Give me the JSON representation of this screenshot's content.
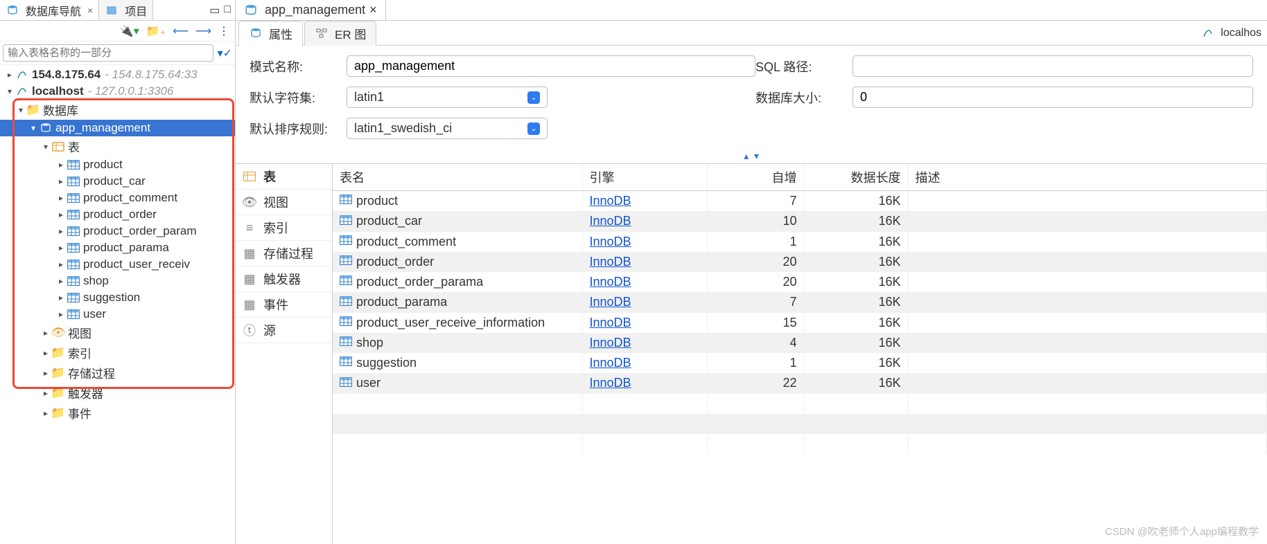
{
  "leftTabs": {
    "nav": "数据库导航",
    "project": "项目"
  },
  "search": {
    "placeholder": "输入表格名称的一部分"
  },
  "servers": [
    {
      "ip": "154.8.175.64",
      "desc": "- 154.8.175.64:33"
    },
    {
      "ip": "localhost",
      "desc": "- 127.0.0.1:3306"
    }
  ],
  "tree": {
    "databasesLabel": "数据库",
    "selectedDb": "app_management",
    "tablesLabel": "表",
    "tables": [
      "product",
      "product_car",
      "product_comment",
      "product_order",
      "product_order_param",
      "product_parama",
      "product_user_receiv",
      "shop",
      "suggestion",
      "user"
    ],
    "categories": [
      "视图",
      "索引",
      "存储过程",
      "触发器",
      "事件"
    ]
  },
  "mainTab": "app_management",
  "subTabs": {
    "props": "属性",
    "er": "ER 图"
  },
  "localhostLabel": "localhos",
  "props": {
    "schemaLabel": "模式名称:",
    "schemaValue": "app_management",
    "charsetLabel": "默认字符集:",
    "charsetValue": "latin1",
    "collationLabel": "默认排序规则:",
    "collationValue": "latin1_swedish_ci",
    "sqlPathLabel": "SQL 路径:",
    "dbSizeLabel": "数据库大小:",
    "dbSizeValue": "0"
  },
  "catList": [
    "表",
    "视图",
    "索引",
    "存储过程",
    "触发器",
    "事件",
    "源"
  ],
  "tableHeaders": {
    "name": "表名",
    "engine": "引擎",
    "autoinc": "自增",
    "dataLen": "数据长度",
    "desc": "描述"
  },
  "rows": [
    {
      "name": "product",
      "engine": "InnoDB",
      "autoinc": "7",
      "dataLen": "16K"
    },
    {
      "name": "product_car",
      "engine": "InnoDB",
      "autoinc": "10",
      "dataLen": "16K"
    },
    {
      "name": "product_comment",
      "engine": "InnoDB",
      "autoinc": "1",
      "dataLen": "16K"
    },
    {
      "name": "product_order",
      "engine": "InnoDB",
      "autoinc": "20",
      "dataLen": "16K"
    },
    {
      "name": "product_order_parama",
      "engine": "InnoDB",
      "autoinc": "20",
      "dataLen": "16K"
    },
    {
      "name": "product_parama",
      "engine": "InnoDB",
      "autoinc": "7",
      "dataLen": "16K"
    },
    {
      "name": "product_user_receive_information",
      "engine": "InnoDB",
      "autoinc": "15",
      "dataLen": "16K"
    },
    {
      "name": "shop",
      "engine": "InnoDB",
      "autoinc": "4",
      "dataLen": "16K"
    },
    {
      "name": "suggestion",
      "engine": "InnoDB",
      "autoinc": "1",
      "dataLen": "16K"
    },
    {
      "name": "user",
      "engine": "InnoDB",
      "autoinc": "22",
      "dataLen": "16K"
    }
  ],
  "watermark": "CSDN @吹老师个人app编程教学"
}
